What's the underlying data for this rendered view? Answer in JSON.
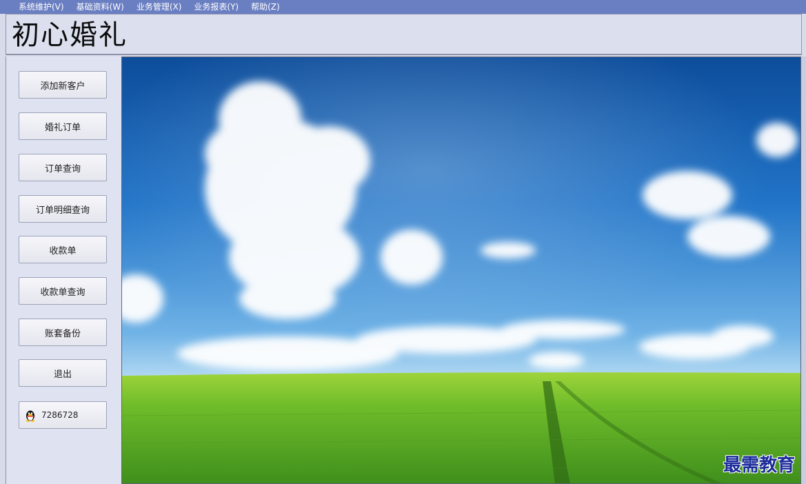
{
  "menu": [
    {
      "label": "系统维护(V)"
    },
    {
      "label": "基础资料(W)"
    },
    {
      "label": "业务管理(X)"
    },
    {
      "label": "业务报表(Y)"
    },
    {
      "label": "帮助(Z)"
    }
  ],
  "title": "初心婚礼",
  "sidebar": {
    "buttons": [
      {
        "label": "添加新客户"
      },
      {
        "label": "婚礼订单"
      },
      {
        "label": "订单查询"
      },
      {
        "label": "订单明细查询"
      },
      {
        "label": "收款单"
      },
      {
        "label": "收款单查询"
      },
      {
        "label": "账套备份"
      },
      {
        "label": "退出"
      }
    ],
    "qq": {
      "number": "7286728",
      "icon": "qq-penguin-icon"
    }
  },
  "watermark": "最需教育",
  "colors": {
    "menubar": "#6a7ec2",
    "sky": "#1f6fc4",
    "grass": "#5aa92a"
  }
}
